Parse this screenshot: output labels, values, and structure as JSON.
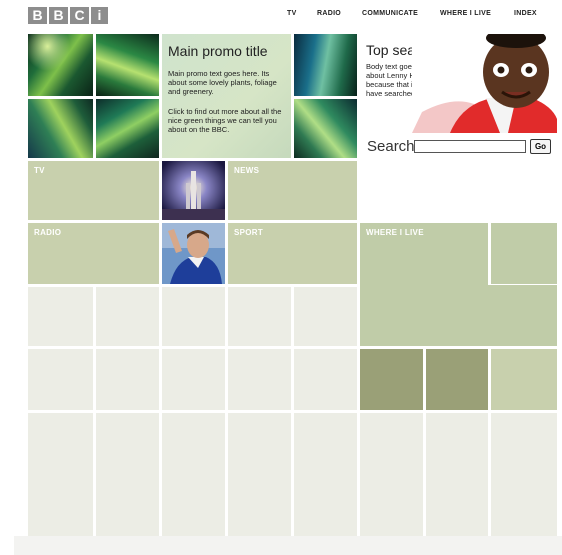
{
  "logo": {
    "letters": [
      "B",
      "B",
      "C",
      "i"
    ]
  },
  "nav": {
    "items": [
      "TV",
      "RADIO",
      "COMMUNICATE",
      "WHERE I LIVE",
      "INDEX"
    ]
  },
  "promo": {
    "title": "Main promo title",
    "body": "Main promo text goes here. Its about some lovely plants, foliage and greenery.",
    "cta": "Click to find out more about all the nice green things we can tell you about on the BBC."
  },
  "top_search": {
    "title": "Top search title",
    "body": "Body text goes here. It is about Lenny Henry today because that is what people have searched for."
  },
  "search": {
    "label": "Search",
    "value": "",
    "button": "Go"
  },
  "sections": {
    "tv": "TV",
    "news": "NEWS",
    "radio": "RADIO",
    "sport": "SPORT",
    "where_i_live": "WHERE I LIVE"
  },
  "colors": {
    "tile_light": "#ecede5",
    "tile_green": "#c8d0ad",
    "tile_dark": "#9aa077",
    "logo_grey": "#8d8d8d"
  }
}
